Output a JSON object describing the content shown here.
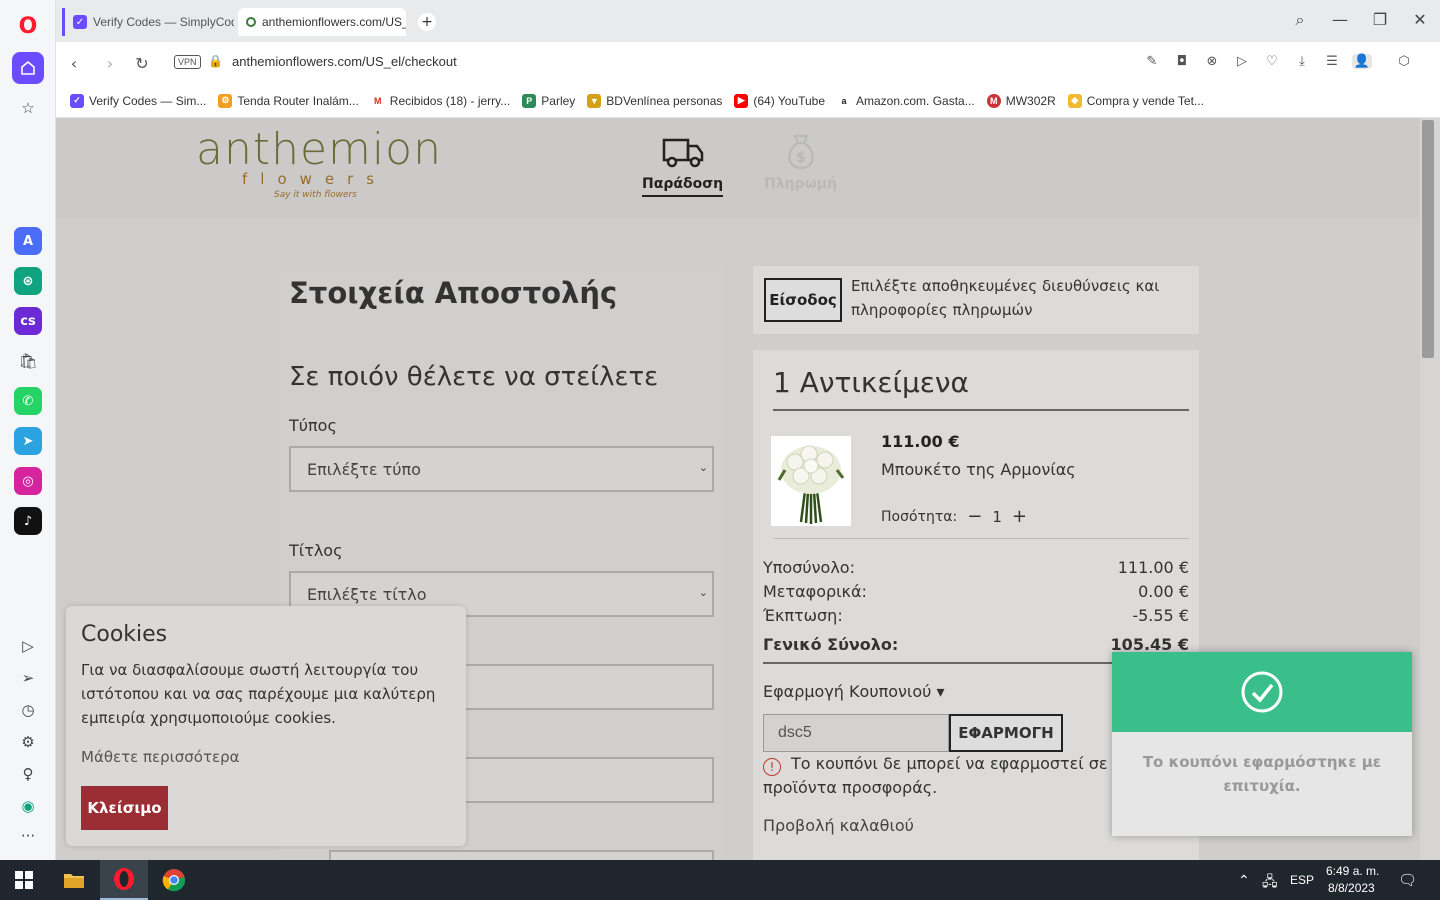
{
  "browser": {
    "tabs": [
      {
        "label": "Verify Codes — SimplyCodes"
      },
      {
        "label": "anthemionflowers.com/US_el/checkout"
      }
    ],
    "url": "anthemionflowers.com/US_el/checkout",
    "vpn_label": "VPN",
    "bookmarks": [
      {
        "label": "Verify Codes — Sim...",
        "color": "#6b4dff"
      },
      {
        "label": "Tenda Router Inalám...",
        "color": "#f0a020"
      },
      {
        "label": "Recibidos (18) - jerry...",
        "color": "#d93025"
      },
      {
        "label": "Parley",
        "color": "#2e8b57"
      },
      {
        "label": "BDVenlínea personas",
        "color": "#d4a017"
      },
      {
        "label": "(64) YouTube",
        "color": "#ff0000"
      },
      {
        "label": "Amazon.com. Gasta...",
        "color": "#222222"
      },
      {
        "label": "MW302R",
        "color": "#cc3333"
      },
      {
        "label": "Compra y vende Tet...",
        "color": "#f3ba2f"
      }
    ]
  },
  "site": {
    "logo_main": "anthemion",
    "logo_sub": "flowers",
    "logo_tag": "Say it with flowers",
    "steps": [
      {
        "label": "Παράδοση",
        "active": true
      },
      {
        "label": "Πληρωμή",
        "active": false
      }
    ]
  },
  "form": {
    "heading": "Στοιχεία Αποστολής",
    "subheading": "Σε ποιόν θέλετε να στείλετε",
    "type_label": "Τύπος",
    "type_placeholder": "Επιλέξτε τύπο",
    "title_label": "Τίτλος",
    "title_placeholder": "Επιλέξτε τίτλο"
  },
  "login": {
    "button": "Είσοδος",
    "text": "Επιλέξτε αποθηκευμένες διευθύνσεις και πληροφορίες πληρωμών"
  },
  "cart": {
    "title": "1 Αντικείμενα",
    "item": {
      "price": "111.00 €",
      "name": "Μπουκέτο της Αρμονίας",
      "qty_label": "Ποσότητα:",
      "qty_minus": "−",
      "qty": "1",
      "qty_plus": "+"
    },
    "summary": {
      "subtotal_label": "Υποσύνολο:",
      "subtotal": "111.00 €",
      "shipping_label": "Μεταφορικά:",
      "shipping": "0.00 €",
      "discount_label": "Έκπτωση:",
      "discount": "-5.55 €",
      "total_label": "Γενικό Σύνολο:",
      "total": "105.45 €"
    },
    "coupon": {
      "toggle": "Εφαρμογή Κουπονιού",
      "value": "dsc5",
      "apply": "ΕΦΑΡΜΟΓΗ",
      "warning": "Το κουπόνι δε μπορεί να εφαρμοστεί σε προϊόντα προσφοράς."
    },
    "view_cart": "Προβολή καλαθιού"
  },
  "cookies": {
    "title": "Cookies",
    "text": "Για να διασφαλίσουμε σωστή λειτουργία του ιστότοπου και να σας παρέχουμε μια καλύτερη εμπειρία χρησιμοποιούμε cookies.",
    "more": "Μάθετε περισσότερα",
    "close": "Κλείσιμο"
  },
  "toast": {
    "message": "Το κουπόνι εφαρμόστηκε με επιτυχία.",
    "color": "#3bbf8a"
  },
  "taskbar": {
    "language": "ESP",
    "time": "6:49 a. m.",
    "date": "8/8/2023"
  }
}
